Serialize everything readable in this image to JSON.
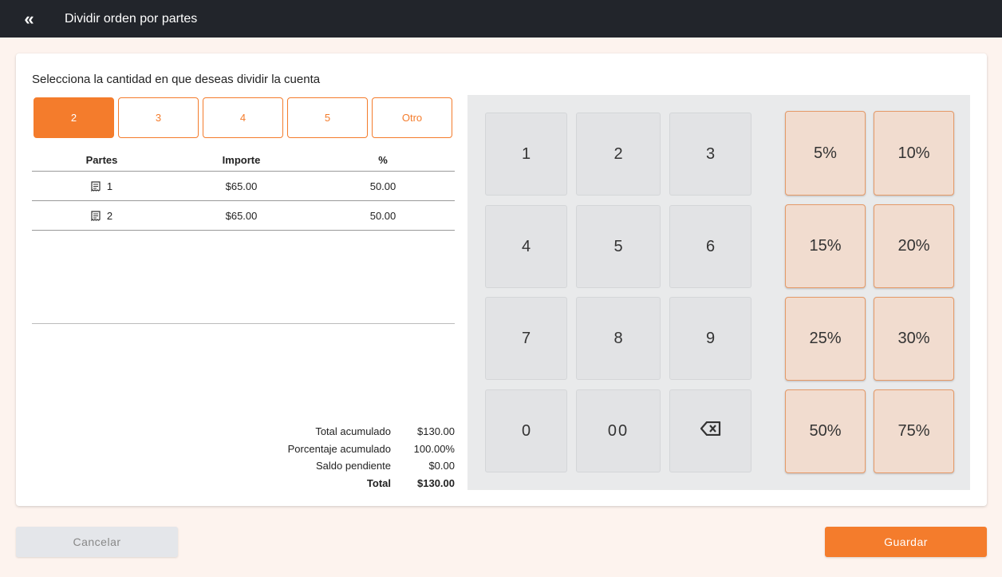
{
  "header": {
    "back_icon": "double-chevron-left-icon",
    "back_glyph": "«",
    "title": "Dividir orden por partes"
  },
  "instruction": "Selecciona la cantidad en que deseas dividir la cuenta",
  "split_options": [
    {
      "label": "2",
      "active": true
    },
    {
      "label": "3",
      "active": false
    },
    {
      "label": "4",
      "active": false
    },
    {
      "label": "5",
      "active": false
    },
    {
      "label": "Otro",
      "active": false
    }
  ],
  "table": {
    "headers": [
      "Partes",
      "Importe",
      "%"
    ],
    "rows": [
      {
        "part": "1",
        "amount": "$65.00",
        "percent": "50.00"
      },
      {
        "part": "2",
        "amount": "$65.00",
        "percent": "50.00"
      }
    ]
  },
  "totals": [
    {
      "label": "Total acumulado",
      "value": "$130.00",
      "bold": false
    },
    {
      "label": "Porcentaje acumulado",
      "value": "100.00%",
      "bold": false
    },
    {
      "label": "Saldo pendiente",
      "value": "$0.00",
      "bold": false
    },
    {
      "label": "Total",
      "value": "$130.00",
      "bold": true
    }
  ],
  "keypad": [
    "1",
    "2",
    "3",
    "4",
    "5",
    "6",
    "7",
    "8",
    "9",
    "0",
    "00",
    "backspace"
  ],
  "percent_keys": [
    "5%",
    "10%",
    "15%",
    "20%",
    "25%",
    "30%",
    "50%",
    "75%"
  ],
  "footer": {
    "cancel_label": "Cancelar",
    "save_label": "Guardar"
  },
  "colors": {
    "accent": "#f47c2c",
    "topbar": "#22252b",
    "background": "#fdf3ee"
  }
}
